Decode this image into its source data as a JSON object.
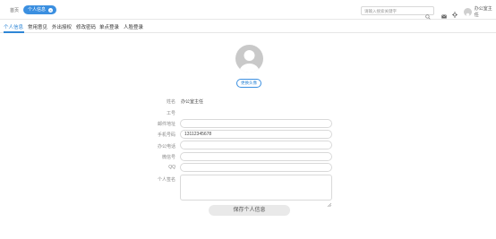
{
  "topbar": {
    "home_label": "首页",
    "active_crumb": "个人信息",
    "search_placeholder": "请输入搜索关键字",
    "username": "办公室主任"
  },
  "tabs": [
    {
      "label": "个人信息",
      "active": true
    },
    {
      "label": "常用意见",
      "active": false
    },
    {
      "label": "外出授权",
      "active": false
    },
    {
      "label": "修改密码",
      "active": false
    },
    {
      "label": "单点登录",
      "active": false
    },
    {
      "label": "人脸登录",
      "active": false
    }
  ],
  "profile": {
    "change_avatar_label": "更换头像",
    "fields": {
      "name_label": "姓名",
      "name_value": "办公室主任",
      "employee_id_label": "工号",
      "email_label": "邮件地址",
      "email_value": "",
      "mobile_label": "手机号码",
      "mobile_value": "13112345678",
      "office_phone_label": "办公电话",
      "office_phone_value": "",
      "wechat_label": "微信号",
      "wechat_value": "",
      "qq_label": "QQ",
      "qq_value": "",
      "signature_label": "个人签名",
      "signature_value": ""
    },
    "save_label": "保存个人信息"
  },
  "colors": {
    "accent": "#2f86d6",
    "pill": "#3b8fe0",
    "avatar_gray": "#c9c9c9",
    "save_bg": "#e9e9e9"
  },
  "icons": [
    "close-icon",
    "search-icon",
    "mail-icon",
    "settings-icon",
    "user-avatar-icon",
    "textarea-resize-icon"
  ]
}
